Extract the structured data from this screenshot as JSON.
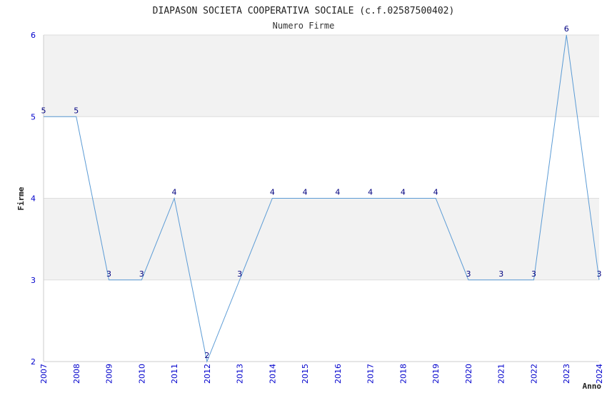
{
  "chart_data": {
    "type": "line",
    "title": "DIAPASON SOCIETA COOPERATIVA SOCIALE (c.f.02587500402)",
    "subtitle": "Numero Firme",
    "xlabel": "Anno",
    "ylabel": "Firme",
    "ylim": [
      2,
      6
    ],
    "yticks": [
      "2",
      "3",
      "4",
      "5",
      "6"
    ],
    "x": [
      "2007",
      "2008",
      "2009",
      "2010",
      "2011",
      "2012",
      "2013",
      "2014",
      "2015",
      "2016",
      "2017",
      "2018",
      "2019",
      "2020",
      "2021",
      "2022",
      "2023",
      "2024"
    ],
    "series": [
      {
        "values": [
          5,
          5,
          3,
          3,
          4,
          2,
          3,
          4,
          4,
          4,
          4,
          4,
          4,
          3,
          3,
          3,
          6,
          3
        ]
      }
    ],
    "colors": {
      "line": "#5b9bd5",
      "band": "#f2f2f2",
      "tick": "#0000cc",
      "label": "#000080"
    },
    "grid": true
  }
}
